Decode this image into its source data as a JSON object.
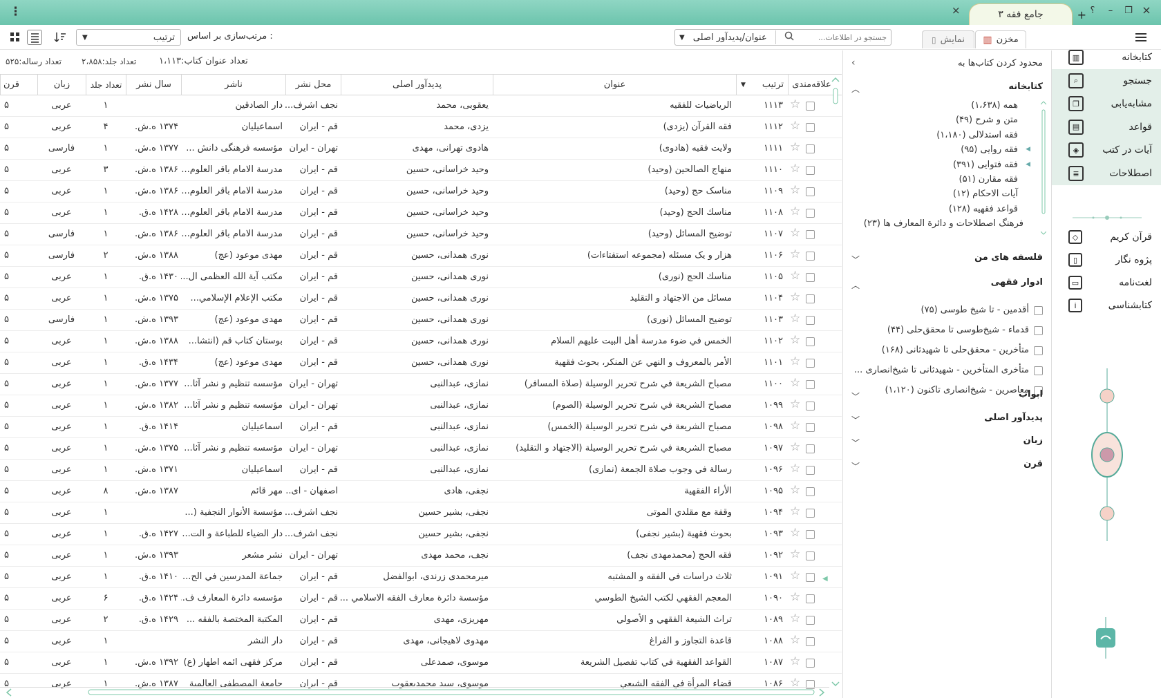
{
  "window": {
    "tab_title": "جامع فقه ۳",
    "tab_new": "+",
    "help": "؟",
    "minimize": "–",
    "restore": "❐",
    "close": "×",
    "menu": "⋮"
  },
  "toolbar": {
    "mokhzan": "مخزن",
    "namayesh": "نمایش",
    "search_placeholder": "جستجو در اطلاعات...",
    "search_field": "عنوان/پدیدآور اصلی",
    "sort_label": "مرتب‌سازی بر اساس :",
    "sort_value": "ترتیب"
  },
  "status": {
    "titles_label": "تعداد عنوان کتاب:",
    "titles_value": "۱،۱۱۳",
    "volumes_label": "تعداد جلد:",
    "volumes_value": "۲،۸۵۸",
    "risala_label": "تعداد رساله:",
    "risala_value": "۵۲۵"
  },
  "columns": {
    "fav": "علاقه‌مندی",
    "num": "ترتیب",
    "title": "عنوان",
    "author": "پدیدآور اصلی",
    "place": "محل نشر",
    "publisher": "ناشر",
    "year": "سال نشر",
    "vols": "تعداد جلد",
    "lang": "زبان",
    "century": "قرن"
  },
  "rows": [
    {
      "num": "۱۱۱۳",
      "title": "الرياضيات للفقيه",
      "author": "یعقوبی، محمد",
      "place": "نجف اشرف...",
      "publisher": "دار الصادقين",
      "year": "",
      "vols": "۱",
      "lang": "عربی",
      "century": "۵"
    },
    {
      "num": "۱۱۱۲",
      "title": "فقه القرآن (یزدی)",
      "author": "یزدی، محمد",
      "place": "قم - ایران",
      "publisher": "اسماعیلیان",
      "year": "۱۳۷۴ ه.ش.",
      "vols": "۴",
      "lang": "عربی",
      "century": "۵"
    },
    {
      "num": "۱۱۱۱",
      "title": "ولایت فقیه (هادوی)",
      "author": "هادوی تهرانی، مهدی",
      "place": "تهران - ایران",
      "publisher": "مؤسسه فرهنگی دانش ...",
      "year": "۱۳۷۷ ه.ش.",
      "vols": "۱",
      "lang": "فارسی",
      "century": "۵"
    },
    {
      "num": "۱۱۱۰",
      "title": "منهاج الصالحين (وحید)",
      "author": "وحید خراسانی، حسین",
      "place": "قم - ایران",
      "publisher": "مدرسة الامام باقر العلوم...",
      "year": "۱۳۸۶ ه.ش.",
      "vols": "۳",
      "lang": "عربی",
      "century": "۵"
    },
    {
      "num": "۱۱۰۹",
      "title": "مناسک حج (وحید)",
      "author": "وحید خراسانی، حسین",
      "place": "قم - ایران",
      "publisher": "مدرسة الامام باقر العلوم...",
      "year": "۱۳۸۶ ه.ش.",
      "vols": "۱",
      "lang": "عربی",
      "century": "۵"
    },
    {
      "num": "۱۱۰۸",
      "title": "مناسك الحج (وحید)",
      "author": "وحید خراسانی، حسین",
      "place": "قم - ایران",
      "publisher": "مدرسة الامام باقر العلوم...",
      "year": "۱۴۲۸ ه.ق.",
      "vols": "۱",
      "lang": "عربی",
      "century": "۵"
    },
    {
      "num": "۱۱۰۷",
      "title": "توضيح المسائل (وحید)",
      "author": "وحید خراسانی، حسین",
      "place": "قم - ایران",
      "publisher": "مدرسة الامام باقر العلوم...",
      "year": "۱۳۸۶ ه.ش.",
      "vols": "۱",
      "lang": "فارسی",
      "century": "۵"
    },
    {
      "num": "۱۱۰۶",
      "title": "هزار و یک مسئله (مجموعه استفتاءات)",
      "author": "نوری همدانی، حسین",
      "place": "قم - ایران",
      "publisher": "مهدی موعود (عج)",
      "year": "۱۳۸۸ ه.ش.",
      "vols": "۲",
      "lang": "فارسی",
      "century": "۵"
    },
    {
      "num": "۱۱۰۵",
      "title": "مناسك الحج (نوری)",
      "author": "نوری همدانی، حسین",
      "place": "قم - ایران",
      "publisher": "مکتب آية الله العظمى ال...",
      "year": "۱۴۳۰ ه.ق.",
      "vols": "۱",
      "lang": "عربی",
      "century": "۵"
    },
    {
      "num": "۱۱۰۴",
      "title": "مسائل من الاجتهاد و التقليد",
      "author": "نوری همدانی، حسین",
      "place": "قم - ایران",
      "publisher": "مكتب الإعلام الإسلامي...",
      "year": "۱۳۷۵ ه.ش.",
      "vols": "۱",
      "lang": "عربی",
      "century": "۵"
    },
    {
      "num": "۱۱۰۳",
      "title": "توضيح المسائل (نوری)",
      "author": "نوری همدانی، حسین",
      "place": "قم - ایران",
      "publisher": "مهدی موعود (عج)",
      "year": "۱۳۹۳ ه.ش.",
      "vols": "۱",
      "lang": "فارسی",
      "century": "۵"
    },
    {
      "num": "۱۱۰۲",
      "title": "الخمس في ضوء مدرسة أهل البيت عليهم السلام",
      "author": "نوری همدانی، حسین",
      "place": "قم - ایران",
      "publisher": "بوستان کتاب قم (انتشا...",
      "year": "۱۳۸۸ ه.ش.",
      "vols": "۱",
      "lang": "عربی",
      "century": "۵"
    },
    {
      "num": "۱۱۰۱",
      "title": "الأمر بالمعروف و النهي عن المنكر، بحوث فقهية",
      "author": "نوری همدانی، حسین",
      "place": "قم - ایران",
      "publisher": "مهدی موعود (عج)",
      "year": "۱۴۳۴ ه.ق.",
      "vols": "۱",
      "lang": "عربی",
      "century": "۵"
    },
    {
      "num": "۱۱۰۰",
      "title": "مصباح الشريعة في شرح تحرير الوسيلة (صلاة المسافر)",
      "author": "نمازی، عبدالنبی",
      "place": "تهران - ایران",
      "publisher": "مؤسسه تنظیم و نشر آثا...",
      "year": "۱۳۷۷ ه.ش.",
      "vols": "۱",
      "lang": "عربی",
      "century": "۵"
    },
    {
      "num": "۱۰۹۹",
      "title": "مصباح الشريعة في شرح تحرير الوسيلة (الصوم)",
      "author": "نمازی، عبدالنبی",
      "place": "تهران - ایران",
      "publisher": "مؤسسه تنظیم و نشر آثا...",
      "year": "۱۳۸۲ ه.ش.",
      "vols": "۱",
      "lang": "عربی",
      "century": "۵"
    },
    {
      "num": "۱۰۹۸",
      "title": "مصباح الشريعة في شرح تحرير الوسيلة (الخمس)",
      "author": "نمازی، عبدالنبی",
      "place": "قم - ایران",
      "publisher": "اسماعیلیان",
      "year": "۱۴۱۴ ه.ق.",
      "vols": "۱",
      "lang": "عربی",
      "century": "۵"
    },
    {
      "num": "۱۰۹۷",
      "title": "مصباح الشريعة في شرح تحرير الوسيلة (الاجتهاد و التقليد)",
      "author": "نمازی، عبدالنبی",
      "place": "تهران - ایران",
      "publisher": "مؤسسه تنظیم و نشر آثا...",
      "year": "۱۳۷۵ ه.ش.",
      "vols": "۱",
      "lang": "عربی",
      "century": "۵"
    },
    {
      "num": "۱۰۹۶",
      "title": "رسالة في وجوب صلاة الجمعة (نمازی)",
      "author": "نمازی، عبدالنبی",
      "place": "قم - ایران",
      "publisher": "اسماعیلیان",
      "year": "۱۳۷۱ ه.ش.",
      "vols": "۱",
      "lang": "عربی",
      "century": "۵"
    },
    {
      "num": "۱۰۹۵",
      "title": "الأراء الفقهية",
      "author": "نجفی، هادی",
      "place": "اصفهان - ای...",
      "publisher": "مهر قائم",
      "year": "۱۳۸۷ ه.ش.",
      "vols": "۸",
      "lang": "عربی",
      "century": "۵"
    },
    {
      "num": "۱۰۹۴",
      "title": "وقفة مع مقلدي الموتى",
      "author": "نجفی، بشیر حسین",
      "place": "نجف اشرف...",
      "publisher": "مؤسسة الأنوار النجفية (...",
      "year": "",
      "vols": "۱",
      "lang": "عربی",
      "century": "۵"
    },
    {
      "num": "۱۰۹۳",
      "title": "بحوث فقهية (بشیر نجفی)",
      "author": "نجفی، بشیر حسین",
      "place": "نجف اشرف...",
      "publisher": "دار الضياء للطباعة و الت...",
      "year": "۱۴۲۷ ه.ق.",
      "vols": "۱",
      "lang": "عربی",
      "century": "۵"
    },
    {
      "num": "۱۰۹۲",
      "title": "فقه الحج (محمدمهدی نجف)",
      "author": "نجف، محمد مهدی",
      "place": "تهران - ایران",
      "publisher": "نشر مشعر",
      "year": "۱۳۹۳ ه.ش.",
      "vols": "۱",
      "lang": "عربی",
      "century": "۵"
    },
    {
      "num": "۱۰۹۱",
      "title": "ثلاث دراسات في الفقه و المشتبه",
      "author": "میرمحمدی زرندی، ابوالفضل",
      "place": "قم - ایران",
      "publisher": "جماعة المدرسين في الح...",
      "year": "۱۴۱۰ ه.ق.",
      "vols": "۱",
      "lang": "عربی",
      "century": "۵"
    },
    {
      "num": "۱۰۹۰",
      "title": "المعجم الفقهي لكتب الشيخ الطوسي",
      "author": "مؤسسة دائرة معارف الفقه الاسلامي ...",
      "place": "قم - ایران",
      "publisher": "مؤسسه دائرة المعارف ف...",
      "year": "۱۴۲۴ ه.ق.",
      "vols": "۶",
      "lang": "عربی",
      "century": "۵"
    },
    {
      "num": "۱۰۸۹",
      "title": "تراث الشيعة الفقهي و الأصولي",
      "author": "مهریزی، مهدی",
      "place": "قم - ایران",
      "publisher": "المكتبة المختصة بالفقه ...",
      "year": "۱۴۲۹ ه.ق.",
      "vols": "۲",
      "lang": "عربی",
      "century": "۵"
    },
    {
      "num": "۱۰۸۸",
      "title": "قاعدة التجاوز و الفراغ",
      "author": "مهدوی لاهیجانی، مهدی",
      "place": "قم - ایران",
      "publisher": "دار النشر",
      "year": "",
      "vols": "۱",
      "lang": "عربی",
      "century": "۵"
    },
    {
      "num": "۱۰۸۷",
      "title": "القواعد الفقهية في كتاب تفصيل الشريعة",
      "author": "موسوی، صمدعلی",
      "place": "قم - ایران",
      "publisher": "مرکز فقهی ائمه اطهار (ع)",
      "year": "۱۳۹۲ ه.ش.",
      "vols": "۱",
      "lang": "عربی",
      "century": "۵"
    },
    {
      "num": "۱۰۸۶",
      "title": "قضاء المرأة في الفقه الشيعي",
      "author": "موسوی، سید محمدیعقوب",
      "place": "قم - ایران",
      "publisher": "جامعة المصطفى العالمية",
      "year": "۱۳۸۷ ه.ش.",
      "vols": "۱",
      "lang": "عربی",
      "century": "۵"
    }
  ],
  "filter": {
    "header": "محدود کردن کتاب‌ها به",
    "library_title": "کتابخانه",
    "library_items": [
      {
        "label": "همه (۱،۶۳۸)",
        "expand": false
      },
      {
        "label": "متن و شرح (۴۹)",
        "expand": false
      },
      {
        "label": "فقه استدلالی (۱،۱۸۰)",
        "expand": false
      },
      {
        "label": "فقه روایی (۹۵)",
        "expand": true
      },
      {
        "label": "فقه فتوایی (۳۹۱)",
        "expand": true
      },
      {
        "label": "فقه مقارن (۵۱)",
        "expand": false
      },
      {
        "label": "آیات الاحکام (۱۲)",
        "expand": false
      },
      {
        "label": "قواعد فقهیه (۱۲۸)",
        "expand": false
      },
      {
        "label": "فرهنگ اصطلاحات و دائرة المعارف ها (۲۳)",
        "expand": false
      }
    ],
    "falsafe": "فلسفه های من",
    "adwar_title": "ادوار فقهی",
    "adwar_items": [
      "أقدمين - تا شیخ طوسی (۷۵)",
      "قدماء - شیخ‌طوسی تا محقق‌حلی (۴۴)",
      "متأخرين - محقق‌حلی تا شهیدثانی (۱۶۸)",
      "متأخری المتأخرين - شهیدثانی تا شیخ‌انصاری ...",
      "معاصرين - شیخ‌انصاری تاکنون (۱،۱۲۰)"
    ],
    "sections": [
      "ابواب",
      "پدیدآور اصلی",
      "زبان",
      "قرن"
    ]
  },
  "sidebar": {
    "items": [
      {
        "label": "کتابخانه",
        "icon": "books-icon"
      },
      {
        "label": "جستجو",
        "icon": "search-icon"
      },
      {
        "label": "مشابه‌یابی",
        "icon": "similar-icon"
      },
      {
        "label": "قواعد",
        "icon": "rules-icon"
      },
      {
        "label": "آیات در کتب",
        "icon": "verses-icon"
      },
      {
        "label": "اصطلاحات",
        "icon": "terms-icon"
      }
    ],
    "items2": [
      {
        "label": "قرآن کریم",
        "icon": "quran-icon"
      },
      {
        "label": "پژوه نگار",
        "icon": "notebook-icon"
      },
      {
        "label": "لغت‌نامه",
        "icon": "dictionary-icon"
      },
      {
        "label": "کتابشناسی",
        "icon": "info-icon"
      }
    ]
  },
  "colors": {
    "accent": "#6cc4ad",
    "sidebar_highlight": "#e3efe9"
  }
}
